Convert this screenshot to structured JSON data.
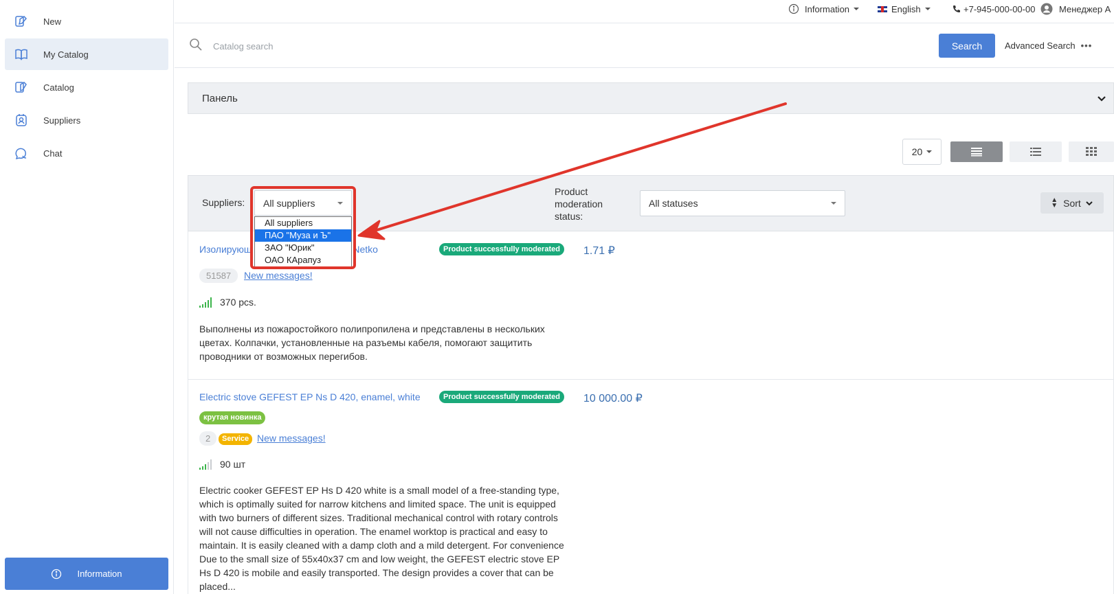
{
  "sidebar": {
    "items": [
      {
        "label": "New",
        "icon": "new-catalog-icon"
      },
      {
        "label": "My Catalog",
        "icon": "book-icon"
      },
      {
        "label": "Catalog",
        "icon": "catalog-icon"
      },
      {
        "label": "Suppliers",
        "icon": "suppliers-icon"
      },
      {
        "label": "Chat",
        "icon": "chat-icon"
      }
    ],
    "active": "My Catalog",
    "info_button": "Information"
  },
  "topbar": {
    "information": "Information",
    "language": "English",
    "phone": "+7-945-000-00-00",
    "user": "Менеджер А"
  },
  "search": {
    "placeholder": "Catalog search",
    "button": "Search",
    "advanced": "Advanced Search",
    "advanced_dots": "•••"
  },
  "panel": {
    "title": "Панель"
  },
  "toolbar": {
    "per_page": "20",
    "views": [
      "list-wide-icon",
      "list-icon",
      "grid-icon"
    ],
    "active_view": "list-wide-icon"
  },
  "filters": {
    "suppliers_label": "Suppliers:",
    "suppliers_value": "All suppliers",
    "suppliers_options": [
      "All suppliers",
      "ПАО \"Муза и Ъ\"",
      "ЗАО \"Юрик\"",
      "ОАО КАрапуз"
    ],
    "suppliers_highlighted": "ПАО \"Муза и Ъ\"",
    "status_label_line1": "Product",
    "status_label_line2": "moderation",
    "status_label_line3": "status:",
    "status_value": "All statuses",
    "sort_label": "Sort"
  },
  "products": [
    {
      "title_start": "Изолирующ",
      "title_end": "зелёный, Netko",
      "status": "Product successfully moderated",
      "price": "1.71 ₽",
      "id": "51587",
      "messages": "New messages!",
      "stock": "370 pcs.",
      "description": "Выполнены из пожаростойкого полипропилена и представлены в нескольких цветах. Колпачки, установленные на разъемы кабеля, помогают защитить проводники от возможных перегибов."
    },
    {
      "title": "Electric stove GEFEST EP Ns D 420, enamel, white",
      "status": "Product successfully moderated",
      "price": "10 000.00 ₽",
      "tag": "крутая новинка",
      "count": "2",
      "service": "Service",
      "messages": "New messages!",
      "stock": "90 шт",
      "description": "Electric cooker GEFEST EP Hs D 420 white is a small model of a free-standing type, which is optimally suited for narrow kitchens and limited space. The unit is equipped with two burners of different sizes. Traditional mechanical control with rotary controls will not cause difficulties in operation. The enamel worktop is practical and easy to maintain. It is easily cleaned with a damp cloth and a mild detergent. For convenience Due to the small size of 55x40x37 cm and low weight, the GEFEST electric stove EP Hs D 420 is mobile and easily transported. The design provides a cover that can be placed..."
    }
  ],
  "colors": {
    "accent": "#4a7fd6",
    "success": "#1aa97a",
    "annotation": "#e0352b"
  }
}
